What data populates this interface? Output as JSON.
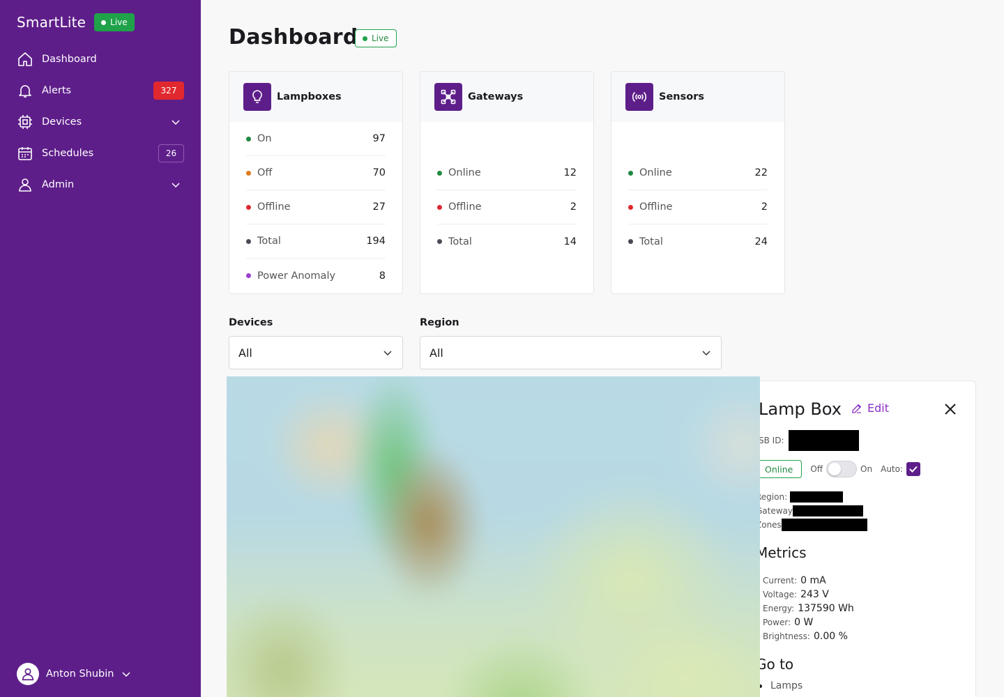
{
  "sidebar": {
    "brand": "SmartLite",
    "live": "Live",
    "items": [
      {
        "label": "Dashboard"
      },
      {
        "label": "Alerts",
        "badge": "327"
      },
      {
        "label": "Devices"
      },
      {
        "label": "Schedules",
        "badge": "26"
      },
      {
        "label": "Admin"
      }
    ],
    "user": "Anton Shubin"
  },
  "main": {
    "title": "Dashboard",
    "live": "Live",
    "cards": [
      {
        "title": "Lampboxes",
        "rows": [
          {
            "label": "On",
            "value": "97",
            "color": "#1f8a3f"
          },
          {
            "label": "Off",
            "value": "70",
            "color": "#e07a1f"
          },
          {
            "label": "Offline",
            "value": "27",
            "color": "#e0282e"
          },
          {
            "label": "Total",
            "value": "194",
            "color": "#4a4a55"
          },
          {
            "label": "Power Anomaly",
            "value": "8",
            "color": "#9b3fd1"
          }
        ]
      },
      {
        "title": "Gateways",
        "rows": [
          {
            "label": "Online",
            "value": "12",
            "color": "#1f8a3f"
          },
          {
            "label": "Offline",
            "value": "2",
            "color": "#e0282e"
          },
          {
            "label": "Total",
            "value": "14",
            "color": "#4a4a55"
          }
        ]
      },
      {
        "title": "Sensors",
        "rows": [
          {
            "label": "Online",
            "value": "22",
            "color": "#1f8a3f"
          },
          {
            "label": "Offline",
            "value": "2",
            "color": "#e0282e"
          },
          {
            "label": "Total",
            "value": "24",
            "color": "#4a4a55"
          }
        ]
      }
    ],
    "filters": {
      "devices_label": "Devices",
      "devices_value": "All",
      "region_label": "Region",
      "region_value": "All"
    }
  },
  "panel": {
    "title": "Lamp Box",
    "edit": "Edit",
    "sbid_label": "SB ID:",
    "status": "Online",
    "off": "Off",
    "on": "On",
    "auto": "Auto:",
    "region_label": "Region:",
    "gateway_label": "Gateway",
    "zones_label": "Zones",
    "metrics_title": "Metrics",
    "metrics": [
      {
        "label": "Current:",
        "value": "0 mA"
      },
      {
        "label": "Voltage:",
        "value": "243 V"
      },
      {
        "label": "Energy:",
        "value": "137590 Wh"
      },
      {
        "label": "Power:",
        "value": "0 W"
      },
      {
        "label": "Brightness:",
        "value": "0.00 %"
      }
    ],
    "goto_title": "Go to",
    "goto_items": [
      "Lamps"
    ]
  },
  "colors": {
    "sidebar": "#5e1e8a",
    "accent": "#8a2fc4",
    "live_green": "#1fa24a",
    "alert_red": "#e0282e"
  }
}
